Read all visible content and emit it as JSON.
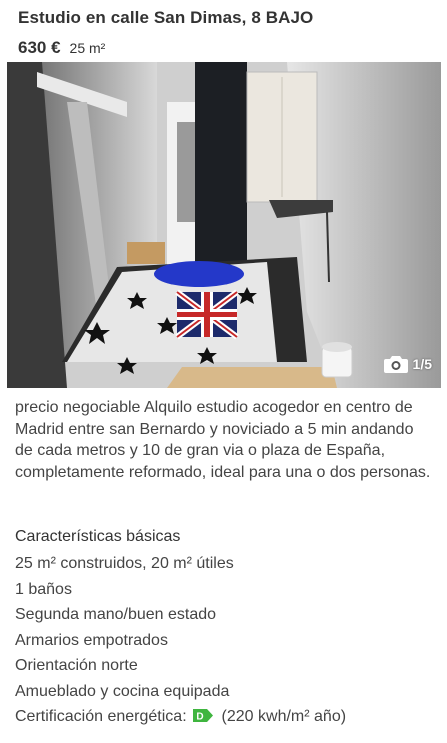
{
  "listing": {
    "title": "Estudio en calle San Dimas, 8  BAJO",
    "price": "630 €",
    "size": "25 m²"
  },
  "photo": {
    "counter": "1/5",
    "icon": "camera-icon"
  },
  "description": "precio negociable Alquilo estudio acogedor en centro de Madrid entre san Bernardo y noviciado a 5 min andando de cada metros y 10 de gran via o plaza de España, completamente reformado, ideal para una o dos personas.",
  "features": {
    "heading": "Características básicas",
    "items": [
      "25 m² construidos, 20 m² útiles",
      "1 baños",
      "Segunda mano/buen estado",
      "Armarios empotrados",
      "Orientación norte",
      "Amueblado y cocina equipada"
    ],
    "energy": {
      "label": "Certificación energética:",
      "rating": "D",
      "badge_color": "#3fb53f",
      "value": "(220 kwh/m² año)"
    }
  }
}
